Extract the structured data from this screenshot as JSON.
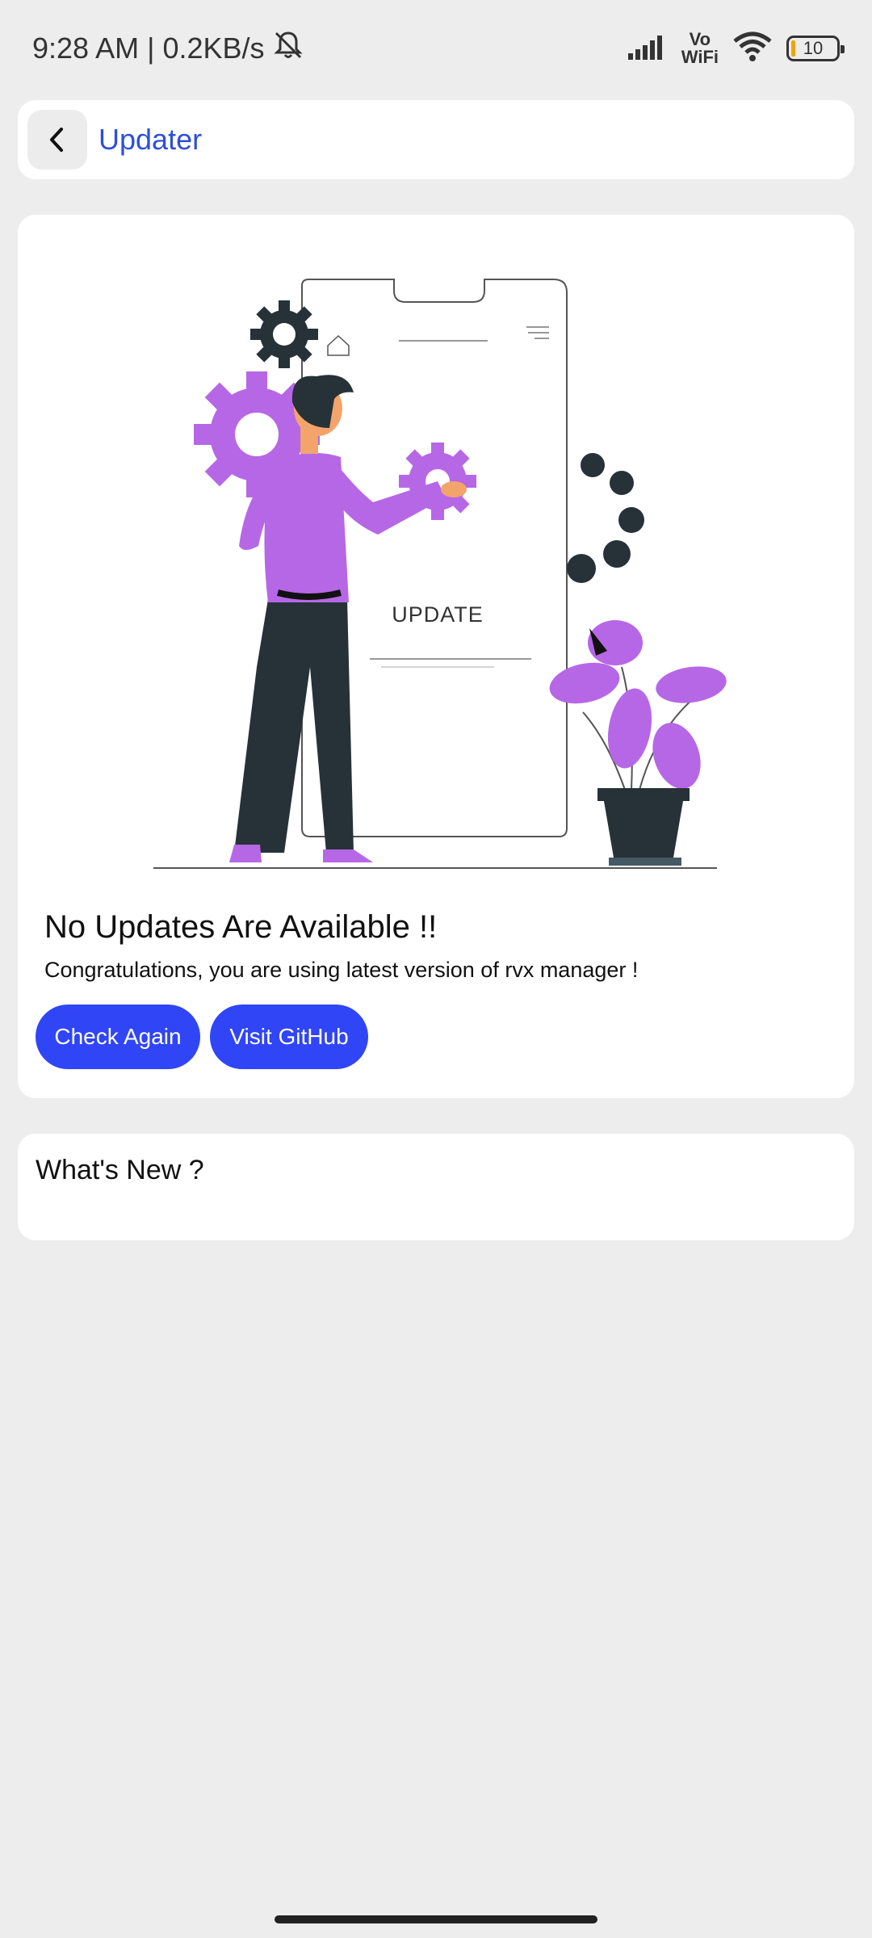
{
  "status_bar": {
    "time_speed": "9:28 AM | 0.2KB/s",
    "vowifi_top": "Vo",
    "vowifi_bottom": "WiFi",
    "battery": "10"
  },
  "appbar": {
    "title": "Updater"
  },
  "update_card": {
    "illustration_text": "UPDATE",
    "title": "No Updates Are Available !!",
    "subtitle": "Congratulations, you are using latest version of rvx manager !",
    "check_again_label": "Check Again",
    "visit_github_label": "Visit GitHub",
    "accent_color": "#2f45f6",
    "illustration_purple": "#b667e6"
  },
  "whats_new": {
    "title": "What's New ?"
  }
}
